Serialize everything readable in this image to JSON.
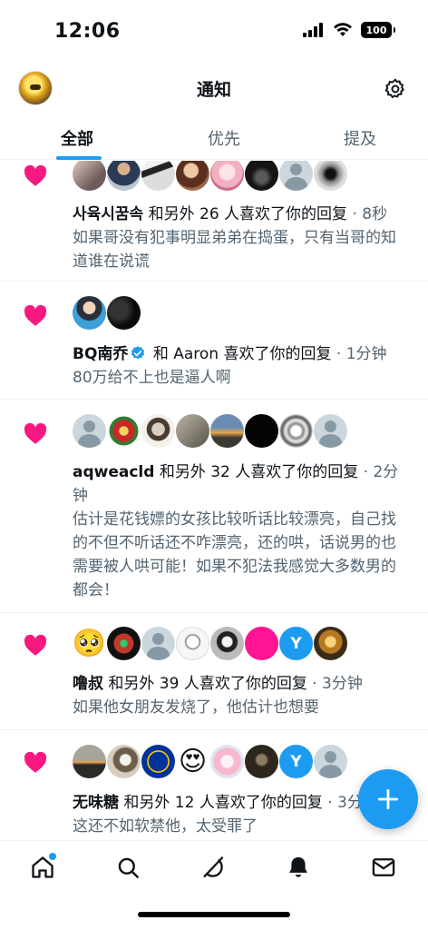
{
  "status": {
    "time": "12:06",
    "battery": "100"
  },
  "header": {
    "title": "通知"
  },
  "tabs": [
    {
      "label": "全部",
      "active": true
    },
    {
      "label": "优先",
      "active": false
    },
    {
      "label": "提及",
      "active": false
    }
  ],
  "notifications": [
    {
      "who": "사육시꿈속",
      "action": " 和另外 26 人喜欢了你的回复",
      "time": " · 8秒",
      "text": "如果哥没有犯事明显弟弟在捣蛋，只有当哥的知道谁在说谎",
      "avatars": [
        "photo-dark",
        "photo-man",
        "photo-anime",
        "photo-warm",
        "photo-pink",
        "photo-dark2",
        "person",
        "photo-bw"
      ]
    },
    {
      "who": "BQ南乔",
      "verified": true,
      "action": " 和 Aaron 喜欢了你的回复",
      "time": " · 1分钟",
      "text": "80万给不上也是逼人啊",
      "avatars": [
        "photo-cartoon",
        "photo-black"
      ]
    },
    {
      "who": "aqweacld",
      "action": " 和另外 32 人喜欢了你的回复",
      "time": " · 2分钟",
      "text": "估计是花钱嫖的女孩比较听话比较漂亮，自己找的不但不听话还不咋漂亮，还的哄，话说男的也需要被人哄可能！如果不犯法我感觉大多数男的都会！",
      "avatars": [
        "person",
        "photo-red",
        "photo-sketch",
        "photo-gray",
        "photo-sunset",
        "photo-black",
        "photo-bw",
        "person"
      ]
    },
    {
      "who": "噜叔",
      "action": " 和另外 39 人喜欢了你的回复",
      "time": " · 3分钟",
      "text": "如果他女朋友发烧了，他估计也想要",
      "avatars": [
        "emoji-pleading",
        "photo-dollar",
        "person",
        "photo-sketch2",
        "photo-manga",
        "pink",
        "Y",
        "photo-gold"
      ]
    },
    {
      "who": "无味糖",
      "action": " 和另外 12 人喜欢了你的回复",
      "time": " · 3分钟",
      "text": "这还不如软禁他，太受罪了",
      "avatars": [
        "photo-sunset2",
        "photo-parrot",
        "photo-eu",
        "emoji-hearteyes",
        "photo-kpop",
        "photo-dark3",
        "Y",
        "person"
      ]
    }
  ],
  "nav": [
    {
      "name": "home",
      "has_dot": true
    },
    {
      "name": "search"
    },
    {
      "name": "grok"
    },
    {
      "name": "notifications"
    },
    {
      "name": "messages"
    }
  ],
  "colors": {
    "accent": "#1d9bf0",
    "heart": "#f91880",
    "secondary_text": "#536471"
  }
}
